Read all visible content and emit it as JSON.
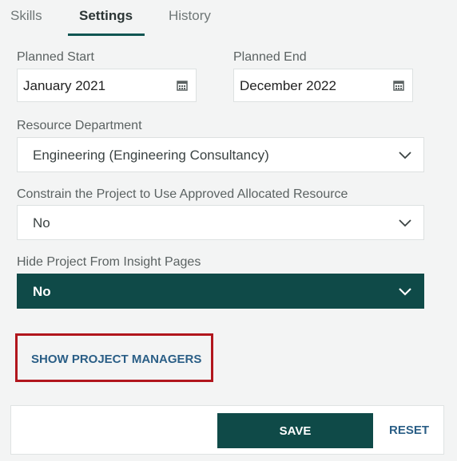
{
  "tabs": [
    {
      "label": "Skills"
    },
    {
      "label": "Settings"
    },
    {
      "label": "History"
    }
  ],
  "planned_start": {
    "label": "Planned Start",
    "value": "January 2021"
  },
  "planned_end": {
    "label": "Planned End",
    "value": "December 2022"
  },
  "resource_department": {
    "label": "Resource Department",
    "value": "Engineering (Engineering Consultancy)"
  },
  "constrain_project": {
    "label": "Constrain the Project to Use Approved Allocated Resource",
    "value": "No"
  },
  "hide_project": {
    "label": "Hide Project From Insight Pages",
    "value": "No"
  },
  "show_project_managers": "SHOW PROJECT MANAGERS",
  "footer": {
    "save_label": "SAVE",
    "reset_label": "RESET"
  },
  "colors": {
    "accent": "#0f4a48",
    "link": "#2a5e86",
    "highlight_border": "#b1161d"
  }
}
